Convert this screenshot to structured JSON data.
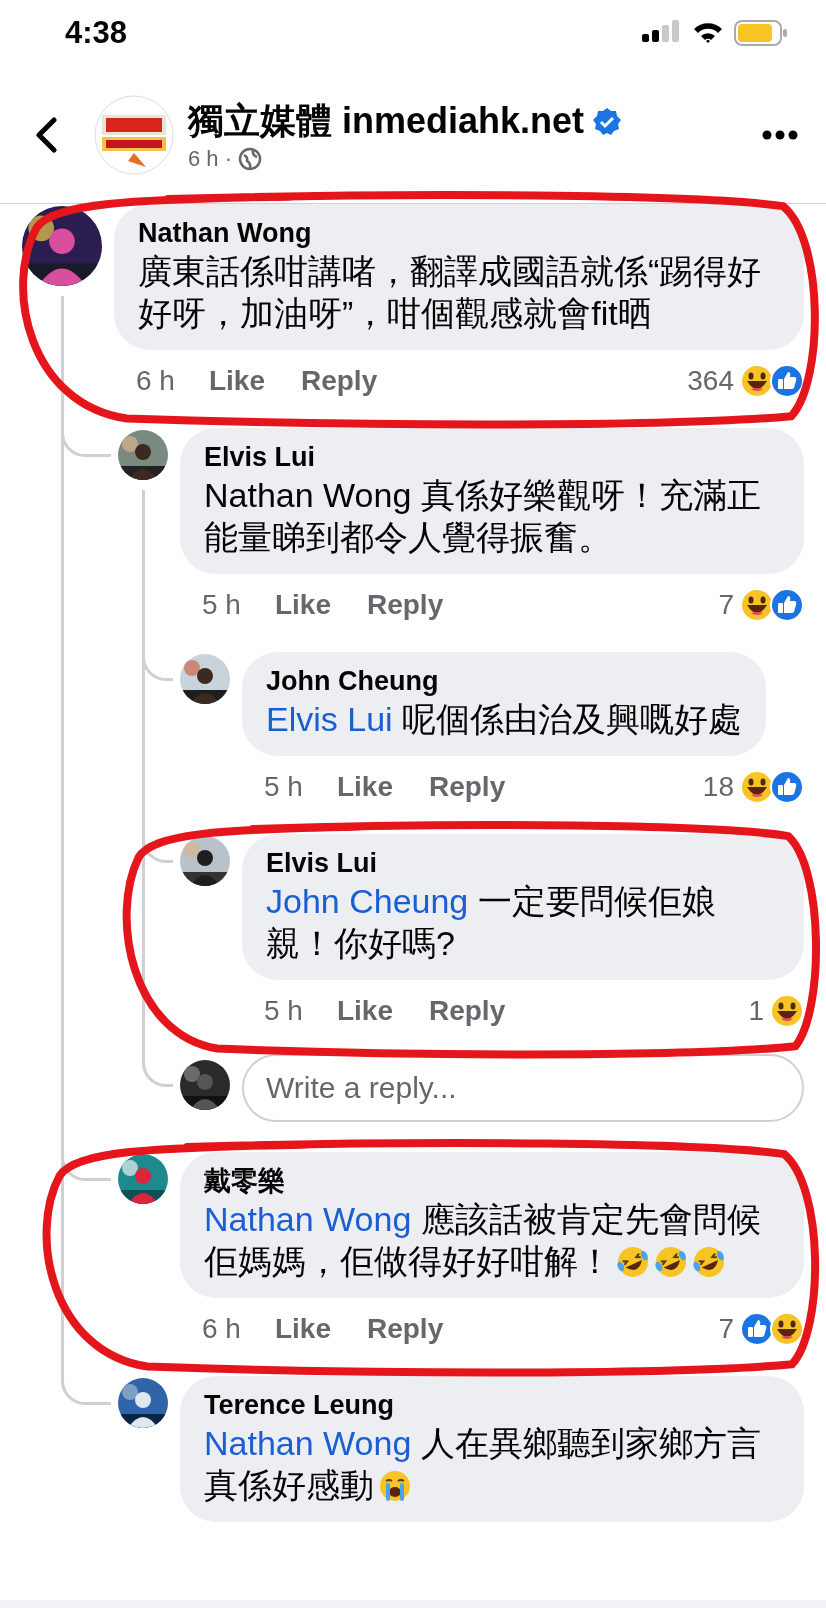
{
  "status_bar": {
    "time": "4:38"
  },
  "header": {
    "title": "獨立媒體 inmediahk.net",
    "verified": true,
    "subtitle": "6 h ·"
  },
  "comments": [
    {
      "kind": "comment",
      "circled": true,
      "name": "Nathan Wong",
      "text": "廣東話係咁講啫，翻譯成國語就係“踢得好好呀，加油呀”，咁個觀感就會fit晒",
      "time": "6 h",
      "like": "Like",
      "reply": "Reply",
      "reaction_count": "364",
      "reactions": [
        {
          "kind": "haha"
        },
        {
          "kind": "like"
        }
      ],
      "children": [
        {
          "kind": "comment",
          "name": "Elvis Lui",
          "text": "Nathan Wong 真係好樂觀呀！充滿正能量睇到都令人覺得振奮。",
          "time": "5 h",
          "like": "Like",
          "reply": "Reply",
          "reaction_count": "7",
          "reactions": [
            {
              "kind": "haha"
            },
            {
              "kind": "like"
            }
          ],
          "children": [
            {
              "kind": "comment",
              "name": "John Cheung",
              "mention": "Elvis Lui",
              "text": "呢個係由治及興嘅好處",
              "time": "5 h",
              "like": "Like",
              "reply": "Reply",
              "reaction_count": "18",
              "reactions": [
                {
                  "kind": "haha"
                },
                {
                  "kind": "like"
                }
              ]
            },
            {
              "kind": "comment",
              "circled": true,
              "name": "Elvis Lui",
              "mention": "John Cheung",
              "text": "一定要問候佢娘親！你好嗎?",
              "time": "5 h",
              "like": "Like",
              "reply": "Reply",
              "reaction_count": "1",
              "reactions": [
                {
                  "kind": "haha"
                }
              ]
            },
            {
              "kind": "reply_field",
              "placeholder": "Write a reply..."
            }
          ]
        },
        {
          "kind": "comment",
          "circled": true,
          "name": "戴零樂",
          "mention": "Nathan Wong",
          "text": "應該話被肯定先會問候佢媽媽，佢做得好好咁解！",
          "emojis": [
            {
              "kind": "rofl"
            },
            {
              "kind": "rofl"
            },
            {
              "kind": "rofl"
            }
          ],
          "time": "6 h",
          "like": "Like",
          "reply": "Reply",
          "reaction_count": "7",
          "reactions": [
            {
              "kind": "like"
            },
            {
              "kind": "haha"
            }
          ]
        },
        {
          "kind": "comment",
          "name": "Terence Leung",
          "mention": "Nathan Wong",
          "text": "人在異鄉聽到家鄉方言真係好感動",
          "emojis": [
            {
              "kind": "sob"
            }
          ]
        }
      ]
    }
  ]
}
